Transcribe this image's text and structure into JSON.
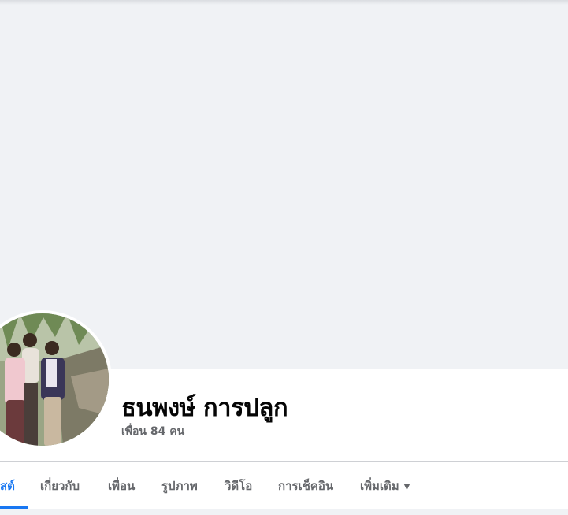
{
  "profile": {
    "name": "ธนพงษ์ การปลูก",
    "friends_count": "เพื่อน 84 คน"
  },
  "tabs": [
    {
      "label": "สต์",
      "active": true
    },
    {
      "label": "เกี่ยวกับ",
      "active": false
    },
    {
      "label": "เพื่อน",
      "active": false
    },
    {
      "label": "รูปภาพ",
      "active": false
    },
    {
      "label": "วิดีโอ",
      "active": false
    },
    {
      "label": "การเช็คอิน",
      "active": false
    },
    {
      "label": "เพิ่มเติม",
      "active": false,
      "icon": "caret-down-icon"
    }
  ],
  "colors": {
    "accent": "#1877f2",
    "cover_background": "#f0f2f5",
    "secondary_text": "#65676b",
    "primary_text": "#050505"
  }
}
